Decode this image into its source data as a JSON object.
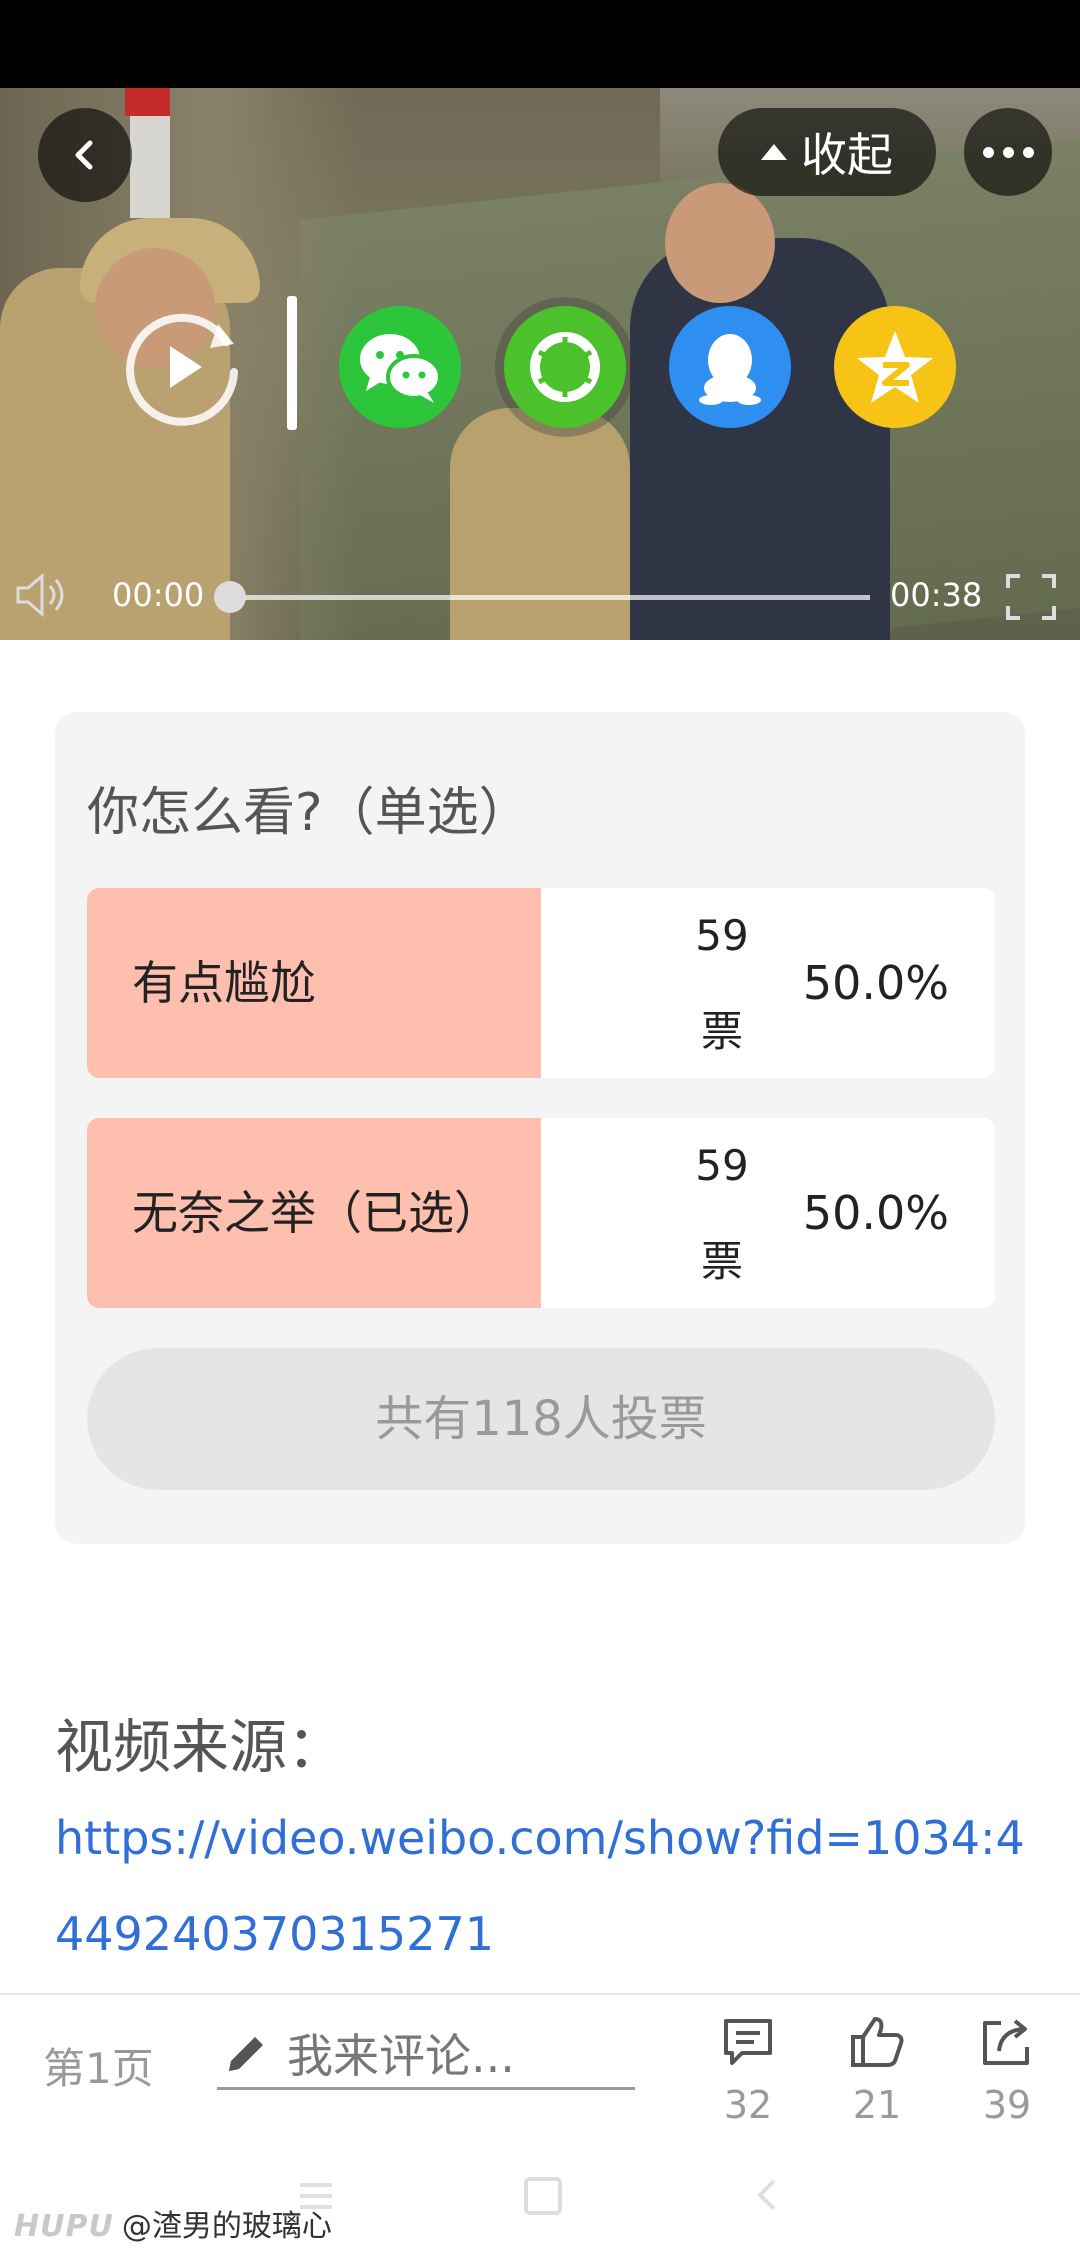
{
  "video": {
    "collapse_label": "收起",
    "time_current": "00:00",
    "time_total": "00:38",
    "progress": 0.0
  },
  "share_icons": [
    "wechat-icon",
    "moments-icon",
    "qq-icon",
    "qzone-icon"
  ],
  "poll": {
    "question": "你怎么看?（单选）",
    "options": [
      {
        "label": "有点尴尬",
        "votes": "59",
        "votes_unit": "票",
        "percent": "50.0%",
        "fraction": 0.5
      },
      {
        "label": "无奈之举（已选）",
        "votes": "59",
        "votes_unit": "票",
        "percent": "50.0%",
        "fraction": 0.5
      }
    ],
    "total": "共有118人投票"
  },
  "source": {
    "title": "视频来源：",
    "url": "https://video.weibo.com/show?fid=1034:4449240370315271"
  },
  "bottom_bar": {
    "page": "第1页",
    "comment_placeholder": "我来评论...",
    "comments": "32",
    "likes": "21",
    "shares": "39"
  },
  "watermark": {
    "brand": "HUPU",
    "user": "@渣男的玻璃心"
  },
  "colors": {
    "poll_fill": "#ffbfae",
    "link": "#2f6fd6"
  }
}
